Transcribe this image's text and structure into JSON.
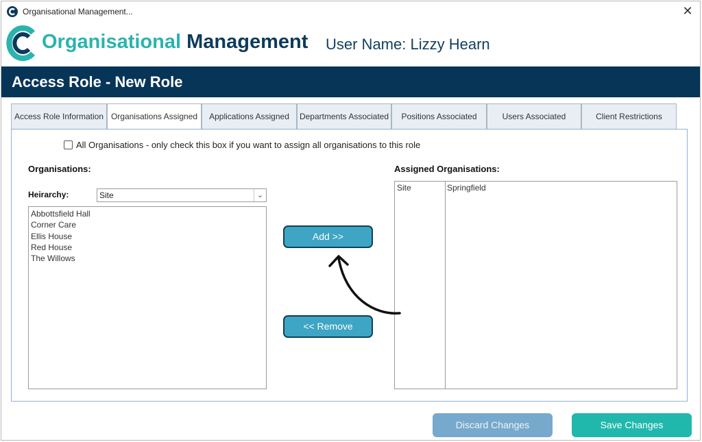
{
  "window": {
    "title": "Organisational Management...",
    "close_glyph": "✕"
  },
  "header": {
    "brand_part1": "Organisational",
    "brand_part2": "Management",
    "user_name": "User Name: Lizzy Hearn"
  },
  "page": {
    "title": "Access Role - New Role"
  },
  "tabs": [
    {
      "label": "Access Role Information"
    },
    {
      "label": "Organisations Assigned",
      "active": true
    },
    {
      "label": "Applications Assigned"
    },
    {
      "label": "Departments Associated"
    },
    {
      "label": "Positions Associated"
    },
    {
      "label": "Users Associated"
    },
    {
      "label": "Client Restrictions"
    }
  ],
  "panel": {
    "all_orgs_label": "All Organisations - only check this box if you want to assign all organisations to this role",
    "all_orgs_checked": false,
    "organisations_heading": "Organisations:",
    "hierarchy_label": "Heirarchy:",
    "hierarchy_value": "Site",
    "organisations": [
      "Abbottsfield Hall",
      "Corner Care",
      "Ellis House",
      "Red House",
      "The Willows"
    ],
    "add_label": "Add  >>",
    "remove_label": "<< Remove",
    "assigned_heading": "Assigned Organisations:",
    "assigned": [
      {
        "type": "Site",
        "name": "Springfield"
      }
    ]
  },
  "footer": {
    "discard_label": "Discard Changes",
    "save_label": "Save Changes"
  },
  "colors": {
    "banner": "#073558",
    "brand_teal": "#2bb3ae",
    "brand_navy": "#0d3a5c",
    "button_teal": "#3ea5c4",
    "save": "#20b8ad",
    "discard": "#77a9cc"
  },
  "icons": {
    "app": "c-logo-icon",
    "close": "close-icon",
    "dropdown": "chevron-down-icon",
    "annotation": "curved-arrow-icon"
  }
}
